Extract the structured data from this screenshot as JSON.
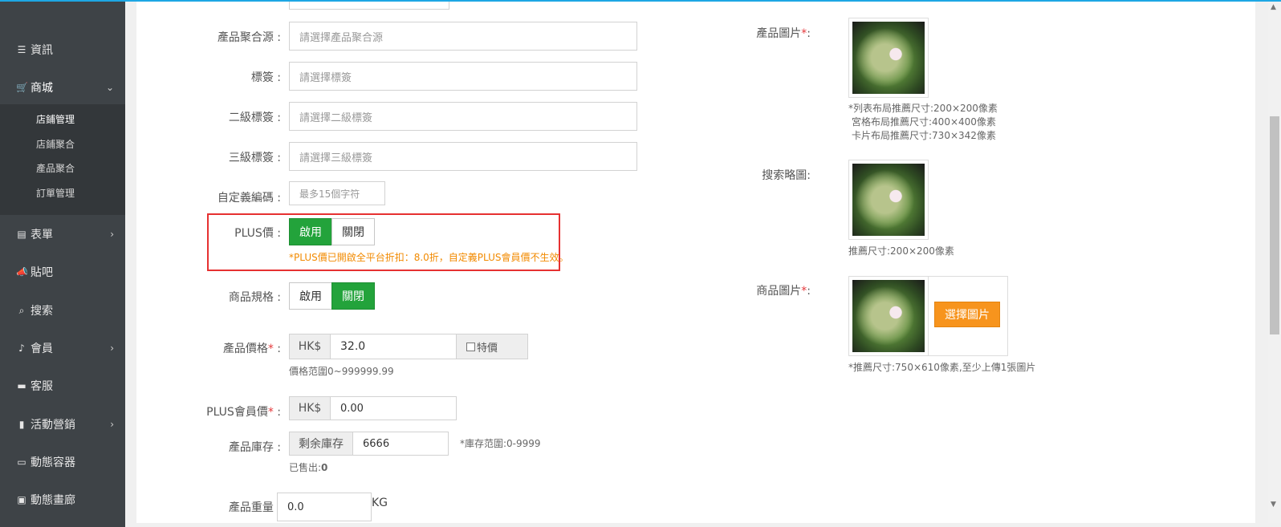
{
  "sidebar": {
    "items": [
      {
        "icon": "list-icon",
        "glyph": "☰",
        "label": "資訊"
      },
      {
        "icon": "cart-icon",
        "glyph": "🛒",
        "label": "商城"
      },
      {
        "icon": "form-icon",
        "glyph": "▤",
        "label": "表單"
      },
      {
        "icon": "megaphone-icon",
        "glyph": "📣",
        "label": "貼吧"
      },
      {
        "icon": "search-icon",
        "glyph": "⌕",
        "label": "搜索"
      },
      {
        "icon": "bell-icon",
        "glyph": "♪",
        "label": "會員"
      },
      {
        "icon": "chat-icon",
        "glyph": "▬",
        "label": "客服"
      },
      {
        "icon": "bookmark-icon",
        "glyph": "▮",
        "label": "活動營銷"
      },
      {
        "icon": "monitor-icon",
        "glyph": "▭",
        "label": "動態容器"
      },
      {
        "icon": "image-icon",
        "glyph": "▣",
        "label": "動態畫廊"
      }
    ],
    "subitems": [
      "店鋪管理",
      "店鋪聚合",
      "產品聚合",
      "訂單管理"
    ]
  },
  "form": {
    "aggregate_source": {
      "label": "產品聚合源 :",
      "placeholder": "請選擇產品聚合源"
    },
    "tag": {
      "label": "標簽 :",
      "placeholder": "請選擇標簽"
    },
    "tag2": {
      "label": "二級標簽 :",
      "placeholder": "請選擇二級標簽"
    },
    "tag3": {
      "label": "三級標簽 :",
      "placeholder": "請選擇三級標簽"
    },
    "custom_code": {
      "label": "自定義編碼 :",
      "placeholder": "最多15個字符"
    },
    "plus_price": {
      "label": "PLUS價 :",
      "on": "啟用",
      "off": "關閉",
      "note": "*PLUS價已開啟全平台折扣：8.0折，自定義PLUS會員價不生效。"
    },
    "spec": {
      "label": "商品規格 :",
      "on": "啟用",
      "off": "關閉"
    },
    "price": {
      "label": "產品價格",
      "colon": " :",
      "currency": "HK$",
      "value": "32.0",
      "special": "特價",
      "hint": "價格范圍0~999999.99"
    },
    "plus_member_price": {
      "label": "PLUS會員價",
      "colon": " :",
      "currency": "HK$",
      "value": "0.00"
    },
    "stock": {
      "label": "產品庫存 :",
      "addon": "剩余庫存",
      "value": "6666",
      "range": "*庫存范圍:0-9999",
      "sold_label": "已售出:",
      "sold_value": "0"
    },
    "weight": {
      "label": "產品重量 :",
      "value": "0.0",
      "unit": "KG"
    }
  },
  "images": {
    "product_image": {
      "label": "產品圖片",
      "colon": ":",
      "hints": [
        "*列表布局推薦尺寸:200×200像素",
        "宮格布局推薦尺寸:400×400像素",
        "卡片布局推薦尺寸:730×342像素"
      ]
    },
    "search_thumb": {
      "label": "搜索略圖:",
      "hint": "推薦尺寸:200×200像素"
    },
    "goods_images": {
      "label": "商品圖片",
      "colon": ":",
      "button": "選擇圖片",
      "hint": "*推薦尺寸:750×610像素,至少上傳1張圖片"
    }
  }
}
